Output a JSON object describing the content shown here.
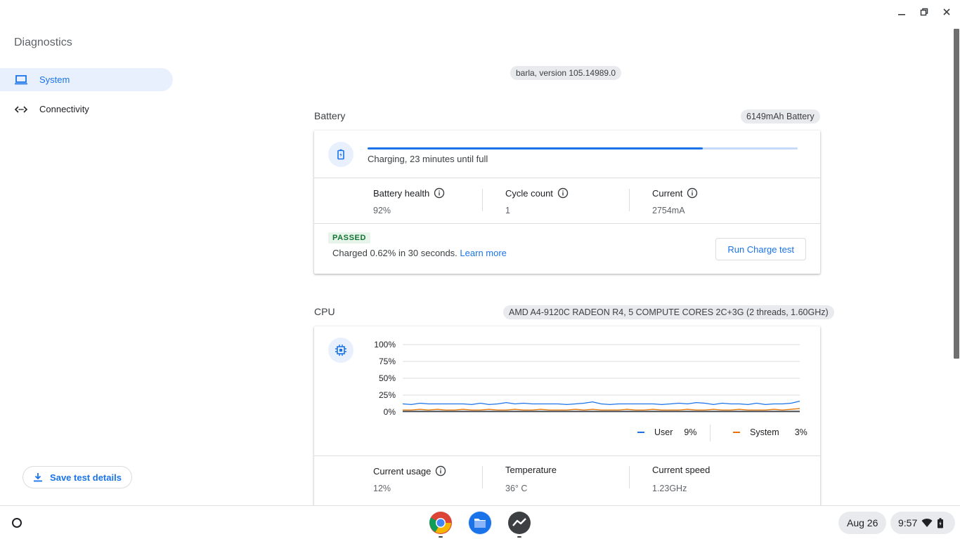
{
  "app": {
    "title": "Diagnostics"
  },
  "nav": {
    "items": [
      {
        "label": "System",
        "active": true
      },
      {
        "label": "Connectivity",
        "active": false
      }
    ]
  },
  "sidebar": {
    "save_label": "Save test details"
  },
  "version": "barla, version 105.14989.0",
  "battery": {
    "title": "Battery",
    "chip": "6149mAh Battery",
    "status": "Charging, 23 minutes until full",
    "progress_fraction": 0.78,
    "stats": [
      {
        "label": "Battery health",
        "value": "92%",
        "info": true
      },
      {
        "label": "Cycle count",
        "value": "1",
        "info": true
      },
      {
        "label": "Current",
        "value": "2754mA",
        "info": true
      }
    ],
    "result_badge": "PASSED",
    "result_text": "Charged 0.62% in 30 seconds.",
    "learn_more": "Learn more",
    "run_label": "Run Charge test"
  },
  "cpu": {
    "title": "CPU",
    "chip": "AMD A4-9120C RADEON R4, 5 COMPUTE CORES 2C+3G (2 threads, 1.60GHz)",
    "legend": [
      {
        "label": "User",
        "value": "9%",
        "color": "#1a73e8"
      },
      {
        "label": "System",
        "value": "3%",
        "color": "#e37400"
      }
    ],
    "stats": [
      {
        "label": "Current usage",
        "value": "12%",
        "info": true
      },
      {
        "label": "Temperature",
        "value": "36° C",
        "info": false
      },
      {
        "label": "Current speed",
        "value": "1.23GHz",
        "info": false
      }
    ]
  },
  "chart_data": {
    "type": "line",
    "title": "",
    "xlabel": "",
    "ylabel": "",
    "ylim": [
      0,
      100
    ],
    "yticks": [
      "100%",
      "75%",
      "50%",
      "25%",
      "0%"
    ],
    "grid": true,
    "series": [
      {
        "name": "User",
        "color": "#1a73e8",
        "values": [
          12,
          11,
          13,
          12,
          12,
          12,
          12,
          12,
          11,
          13,
          11,
          12,
          14,
          12,
          13,
          12,
          12,
          12,
          12,
          11,
          12,
          13,
          15,
          12,
          11,
          12,
          12,
          12,
          12,
          12,
          11,
          12,
          13,
          12,
          14,
          13,
          11,
          13,
          12,
          12,
          11,
          13,
          11,
          12,
          12,
          13,
          16
        ]
      },
      {
        "name": "System",
        "color": "#e37400",
        "values": [
          3,
          3,
          4,
          3,
          4,
          3,
          3,
          4,
          3,
          3,
          4,
          3,
          3,
          4,
          3,
          3,
          4,
          3,
          3,
          3,
          4,
          3,
          4,
          3,
          3,
          3,
          4,
          3,
          3,
          4,
          3,
          3,
          3,
          4,
          3,
          3,
          4,
          3,
          3,
          4,
          3,
          3,
          3,
          4,
          3,
          4,
          5
        ]
      },
      {
        "color": "#202124",
        "values": [
          1,
          1,
          1,
          1,
          1,
          1,
          1,
          1,
          1,
          1,
          1,
          1,
          1,
          1,
          1,
          1,
          1,
          1,
          1,
          1,
          1,
          1,
          1,
          1,
          1,
          1,
          1,
          1,
          1,
          1,
          1,
          1,
          1,
          1,
          1,
          1,
          1,
          1,
          1,
          1,
          1,
          1,
          1,
          1,
          1,
          1,
          1
        ]
      }
    ]
  },
  "shelf": {
    "date": "Aug 26",
    "time": "9:57",
    "apps": [
      {
        "name": "chrome-app-icon"
      },
      {
        "name": "files-app-icon"
      },
      {
        "name": "diagnostics-app-icon"
      }
    ]
  },
  "colors": {
    "accent": "#1a73e8",
    "nav_active_bg": "#e8f0fe",
    "passed_bg": "#e6f4ea",
    "passed_text": "#137333"
  }
}
